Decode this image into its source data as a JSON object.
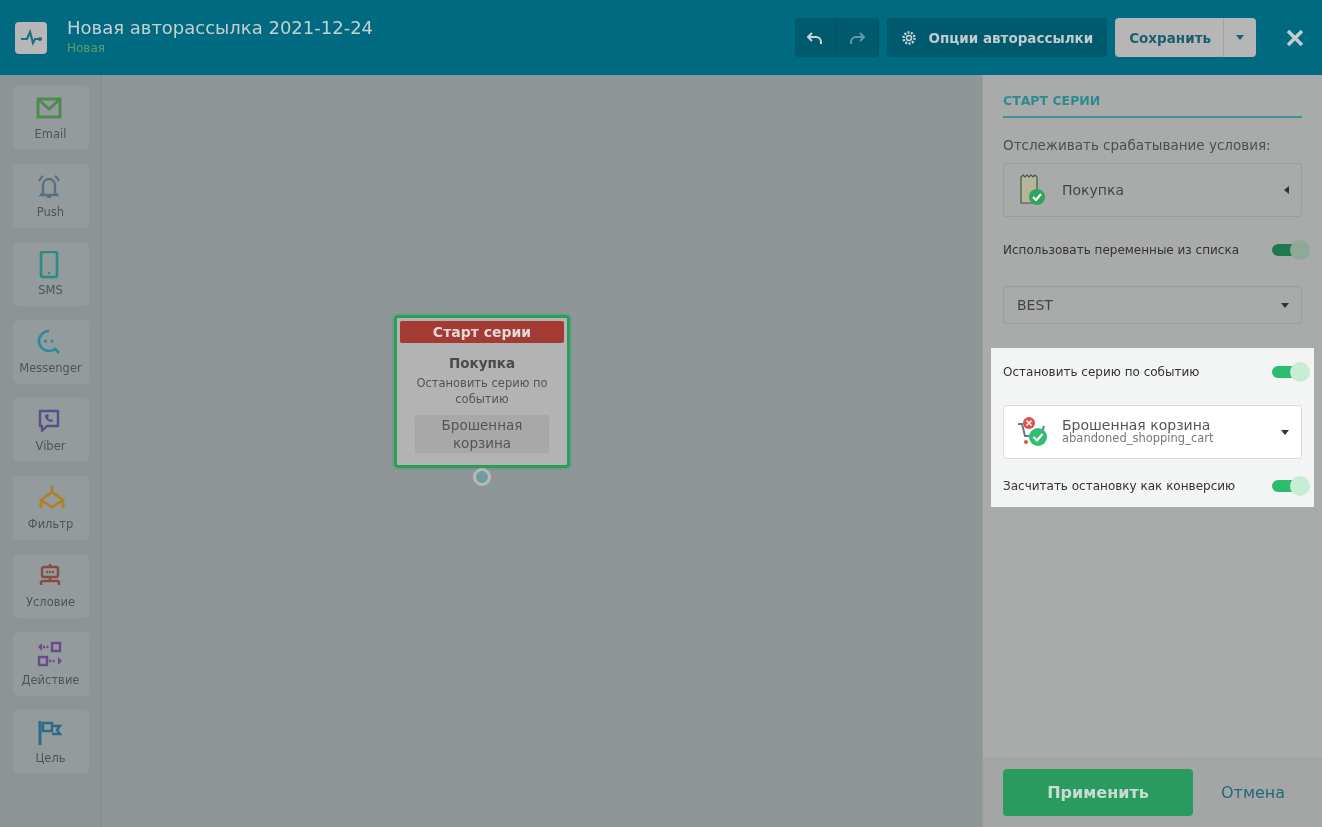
{
  "header": {
    "title": "Новая авторассылка 2021-12-24",
    "status": "Новая",
    "options_button": "Опции авторассылки",
    "save_button": "Сохранить"
  },
  "sidebar": {
    "items": [
      {
        "label": "Email"
      },
      {
        "label": "Push"
      },
      {
        "label": "SMS"
      },
      {
        "label": "Messenger"
      },
      {
        "label": "Viber"
      },
      {
        "label": "Фильтр"
      },
      {
        "label": "Условие"
      },
      {
        "label": "Действие"
      },
      {
        "label": "Цель"
      }
    ]
  },
  "canvas": {
    "node": {
      "selected": true,
      "header": "Старт серии",
      "event": "Покупка",
      "note": "Остановить серию по событию",
      "tag": "Брошенная корзина"
    }
  },
  "panel": {
    "section_title": "СТАРТ СЕРИИ",
    "track_label": "Отслеживать срабатывание условия:",
    "rows": [
      {
        "kind": "event_select",
        "value": "Покупка"
      },
      {
        "kind": "toggle",
        "label": "Использовать переменные из списка",
        "on": true
      },
      {
        "kind": "select",
        "value": "BEST"
      }
    ],
    "highlight_rows": [
      {
        "kind": "toggle",
        "label": "Остановить серию по событию",
        "on": true
      },
      {
        "kind": "cart_select",
        "value": "Брошенная корзина",
        "subvalue": "abandoned_shopping_cart"
      },
      {
        "kind": "toggle",
        "label": "Засчитать остановку как конверсию",
        "on": true
      }
    ]
  },
  "footer": {
    "apply_button": "Применить",
    "cancel_link": "Отмена"
  }
}
